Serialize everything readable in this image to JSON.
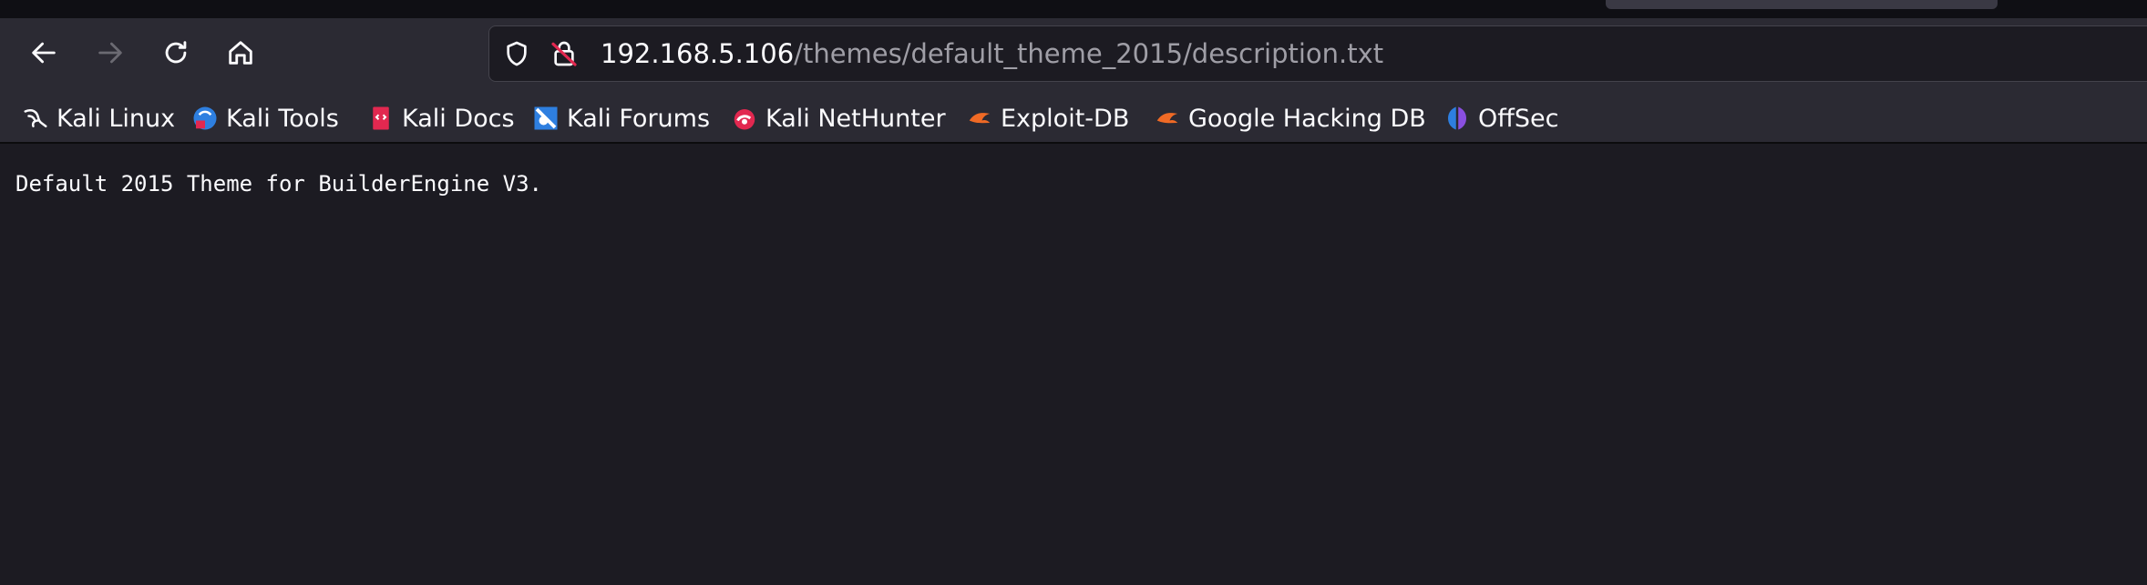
{
  "url": {
    "host": "192.168.5.106",
    "path": "/themes/default_theme_2015/description.txt"
  },
  "bookmarks": [
    {
      "label": "Kali Linux",
      "icon": "kali-dragon-icon"
    },
    {
      "label": "Kali Tools",
      "icon": "kali-tools-icon"
    },
    {
      "label": "Kali Docs",
      "icon": "kali-docs-icon"
    },
    {
      "label": "Kali Forums",
      "icon": "kali-forums-icon"
    },
    {
      "label": "Kali NetHunter",
      "icon": "kali-nethunter-icon"
    },
    {
      "label": "Exploit-DB",
      "icon": "exploit-db-icon"
    },
    {
      "label": "Google Hacking DB",
      "icon": "ghdb-icon"
    },
    {
      "label": "OffSec",
      "icon": "offsec-icon"
    }
  ],
  "page": {
    "text": "Default 2015 Theme for BuilderEngine V3."
  },
  "colors": {
    "background": "#1c1b22",
    "toolbar": "#2b2a33",
    "text": "#fbfbfe",
    "url_path": "#9f9ea6",
    "insecure_lock_accent": "#e22850",
    "brand_orange": "#f06a25"
  }
}
